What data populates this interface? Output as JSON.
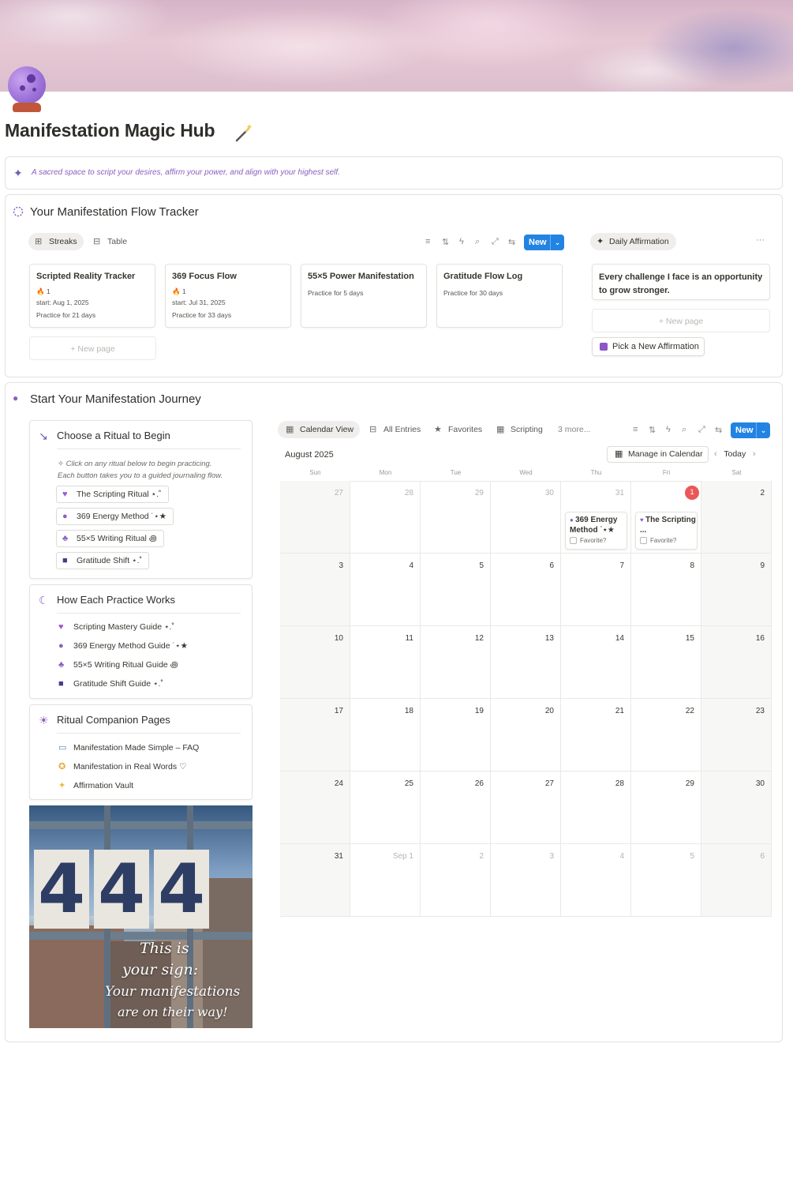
{
  "page": {
    "title": "Manifestation Magic Hub",
    "callout": "A sacred space to script your desires, affirm your power, and align with your highest self."
  },
  "tracker": {
    "title": "Your Manifestation Flow Tracker",
    "tabs": [
      "Streaks",
      "Table"
    ],
    "new_label": "New",
    "cards": [
      {
        "title": "Scripted Reality Tracker",
        "streak": "1",
        "start": "start: Aug 1, 2025",
        "practice": "Practice for 21 days"
      },
      {
        "title": "369 Focus Flow",
        "streak": "1",
        "start": "start: Jul 31, 2025",
        "practice": "Practice for 33 days"
      },
      {
        "title": "55×5 Power Manifestation",
        "practice": "Practice for 5 days"
      },
      {
        "title": "Gratitude Flow Log",
        "practice": "Practice for 30 days"
      }
    ],
    "new_page": "New page",
    "affirmation_tab": "Daily Affirmation",
    "more": "···",
    "affirmation": "Every challenge I face is an opportunity to grow stronger.",
    "affirmation_new_page": "New page",
    "pick_button": "Pick a New Affirmation"
  },
  "journey": {
    "title": "Start Your Manifestation Journey",
    "choose": {
      "title": "Choose a Ritual to Begin",
      "note_line1": "✧ Click on any ritual below to begin practicing.",
      "note_line2": "Each button takes you to a guided journaling flow.",
      "buttons": [
        "The Scripting Ritual ⋆.˚",
        "369 Energy Method ˙⋆★",
        "55×5 Writing Ritual ꩜",
        "Gratitude Shift ⋆.˚"
      ]
    },
    "how": {
      "title": "How Each Practice Works",
      "items": [
        "Scripting Mastery Guide ⋆.˚",
        "369 Energy Method Guide ˙⋆★",
        "55×5 Writing Ritual Guide ꩜",
        "Gratitude Shift Guide ⋆.˚"
      ]
    },
    "companion": {
      "title": "Ritual Companion Pages",
      "items": [
        "Manifestation Made Simple – FAQ",
        "Manifestation in Real Words ♡",
        "Affirmation Vault"
      ]
    },
    "photo": {
      "number": "444",
      "lines": [
        "This is",
        "your sign:",
        "Your manifestations",
        "are on their way!"
      ]
    }
  },
  "calendar": {
    "tabs": [
      "Calendar View",
      "All Entries",
      "Favorites",
      "Scripting",
      "3 more..."
    ],
    "new_label": "New",
    "month": "August 2025",
    "manage": "Manage in Calendar",
    "today": "Today",
    "days": [
      "Sun",
      "Mon",
      "Tue",
      "Wed",
      "Thu",
      "Fri",
      "Sat"
    ],
    "weeks": [
      [
        "27",
        "28",
        "29",
        "30",
        "31",
        "1",
        "2"
      ],
      [
        "3",
        "4",
        "5",
        "6",
        "7",
        "8",
        "9"
      ],
      [
        "10",
        "11",
        "12",
        "13",
        "14",
        "15",
        "16"
      ],
      [
        "17",
        "18",
        "19",
        "20",
        "21",
        "22",
        "23"
      ],
      [
        "24",
        "25",
        "26",
        "27",
        "28",
        "29",
        "30"
      ],
      [
        "31",
        "Sep 1",
        "2",
        "3",
        "4",
        "5",
        "6"
      ]
    ],
    "events": [
      {
        "title": "369 Energy Method ˙⋆★",
        "favorite": "Favorite?"
      },
      {
        "title": "The Scripting ...",
        "favorite": "Favorite?"
      }
    ]
  },
  "colors": {
    "accent": "#2383e2",
    "purple": "#8b5fbf",
    "today": "#eb5757"
  }
}
